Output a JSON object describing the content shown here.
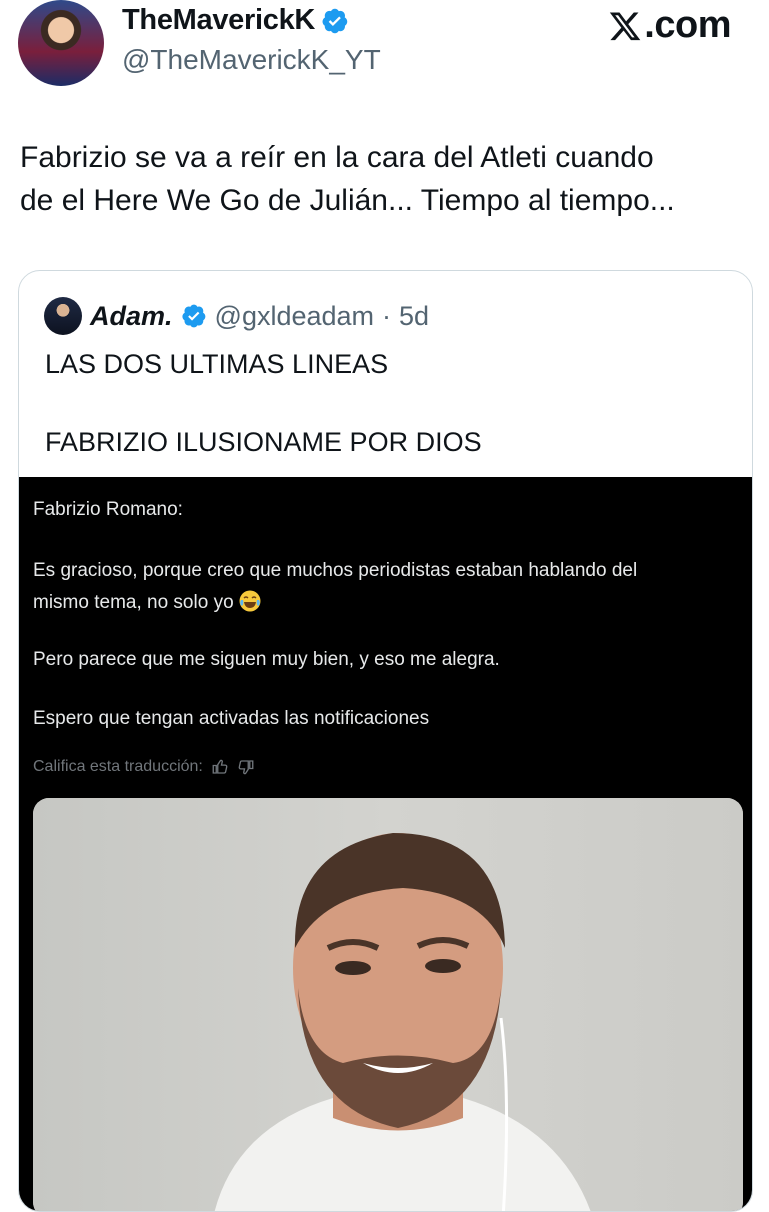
{
  "author": {
    "display_name": "TheMaverickK",
    "handle": "@TheMaverickK_YT"
  },
  "brand": {
    "logo_text": ".com"
  },
  "tweet": {
    "text_line1": "Fabrizio se va a reír en la cara del Atleti cuando",
    "text_line2": "de el Here We Go de Julián... Tiempo al tiempo..."
  },
  "quoted": {
    "display_name": "Adam.",
    "handle": "@gxldeadam",
    "separator": "·",
    "time": "5d",
    "line1": "LAS DOS ULTIMAS LINEAS",
    "line2": "FABRIZIO ILUSIONAME POR DIOS",
    "translation": {
      "speaker": "Fabrizio Romano:",
      "p1a": "Es gracioso, porque creo que muchos periodistas estaban hablando del",
      "p1b": "mismo tema, no solo yo",
      "p2": "Pero parece que me siguen muy bien, y eso me alegra.",
      "p3": "Espero que tengan activadas las notificaciones",
      "rate_label": "Califica esta traducción:"
    }
  },
  "colors": {
    "verified": "#1d9bf0",
    "text": "#0f1419",
    "secondary": "#536471",
    "media_bg": "#000000"
  },
  "icons": [
    "verified-badge-icon",
    "x-logo-icon",
    "thumbs-up-icon",
    "thumbs-down-icon",
    "laughing-tears-emoji-icon"
  ]
}
